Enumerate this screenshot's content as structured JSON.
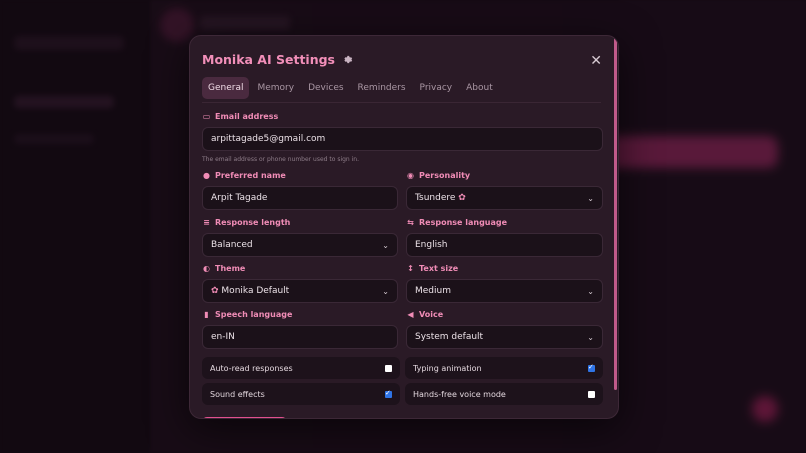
{
  "modal": {
    "title": "Monika AI Settings",
    "gear_icon": "gear-icon",
    "close_icon": "close-icon",
    "close_glyph": "✕"
  },
  "tabs": [
    {
      "label": "General",
      "active": true
    },
    {
      "label": "Memory"
    },
    {
      "label": "Devices"
    },
    {
      "label": "Reminders"
    },
    {
      "label": "Privacy"
    },
    {
      "label": "About"
    }
  ],
  "email": {
    "label": "Email address",
    "icon": "id-card-icon",
    "value": "arpittagade5@gmail.com",
    "hint": "The email address or phone number used to sign in."
  },
  "preferred_name": {
    "label": "Preferred name",
    "icon": "person-icon",
    "value": "Arpit Tagade"
  },
  "personality": {
    "label": "Personality",
    "icon": "brain-icon",
    "value": "Tsundere",
    "value_icon": "flower-icon"
  },
  "response_length": {
    "label": "Response length",
    "icon": "lines-icon",
    "value": "Balanced"
  },
  "response_language": {
    "label": "Response language",
    "icon": "translate-icon",
    "value": "English"
  },
  "theme": {
    "label": "Theme",
    "icon": "palette-icon",
    "value": "Monika Default",
    "value_icon": "flower-icon"
  },
  "text_size": {
    "label": "Text size",
    "icon": "text-size-icon",
    "value": "Medium"
  },
  "speech_language": {
    "label": "Speech language",
    "icon": "microphone-icon",
    "value": "en-IN"
  },
  "voice": {
    "label": "Voice",
    "icon": "speaker-icon",
    "value": "System default"
  },
  "toggles": {
    "auto_read": {
      "label": "Auto-read responses",
      "checked": false
    },
    "typing_animation": {
      "label": "Typing animation",
      "checked": true
    },
    "sound_effects": {
      "label": "Sound effects",
      "checked": true
    },
    "hands_free": {
      "label": "Hands-free voice mode",
      "checked": false
    }
  },
  "colors": {
    "accent": "#f08cb6",
    "title": "#f28fb9",
    "panel": "#2a1a26",
    "field": "#1b1119",
    "checkbox_on": "#2f74e6",
    "primary_button": "#e2508f"
  }
}
